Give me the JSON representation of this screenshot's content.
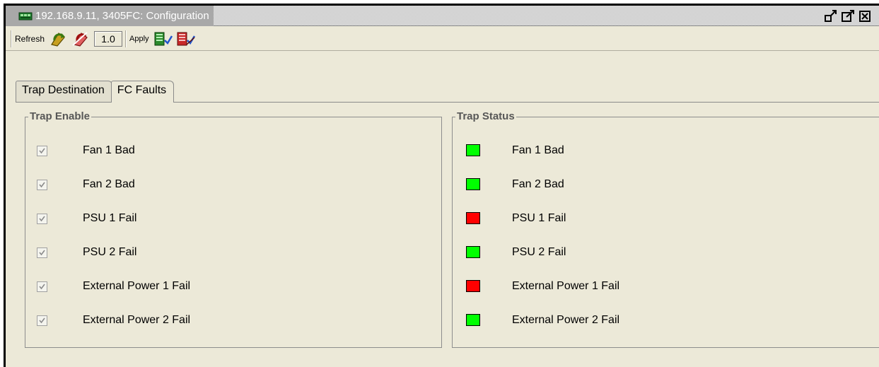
{
  "window": {
    "title": "192.168.9.11, 3405FC: Configuration"
  },
  "toolbar": {
    "refresh_label": "Refresh",
    "zoom_value": "1.0",
    "apply_label": "Apply"
  },
  "tabs": [
    {
      "label": "Trap Destination",
      "active": false
    },
    {
      "label": "FC Faults",
      "active": true
    }
  ],
  "trap_enable": {
    "title": "Trap Enable",
    "items": [
      {
        "label": "Fan 1 Bad",
        "checked": true
      },
      {
        "label": "Fan 2 Bad",
        "checked": true
      },
      {
        "label": "PSU 1 Fail",
        "checked": true
      },
      {
        "label": "PSU 2 Fail",
        "checked": true
      },
      {
        "label": "External Power 1 Fail",
        "checked": true
      },
      {
        "label": "External Power 2 Fail",
        "checked": true
      }
    ]
  },
  "trap_status": {
    "title": "Trap Status",
    "items": [
      {
        "label": "Fan 1 Bad",
        "status": "ok"
      },
      {
        "label": "Fan 2 Bad",
        "status": "ok"
      },
      {
        "label": "PSU 1 Fail",
        "status": "fail"
      },
      {
        "label": "PSU 2 Fail",
        "status": "ok"
      },
      {
        "label": "External Power 1 Fail",
        "status": "fail"
      },
      {
        "label": "External Power 2 Fail",
        "status": "ok"
      }
    ]
  },
  "colors": {
    "status_ok": "#00ff00",
    "status_fail": "#ff0000"
  }
}
